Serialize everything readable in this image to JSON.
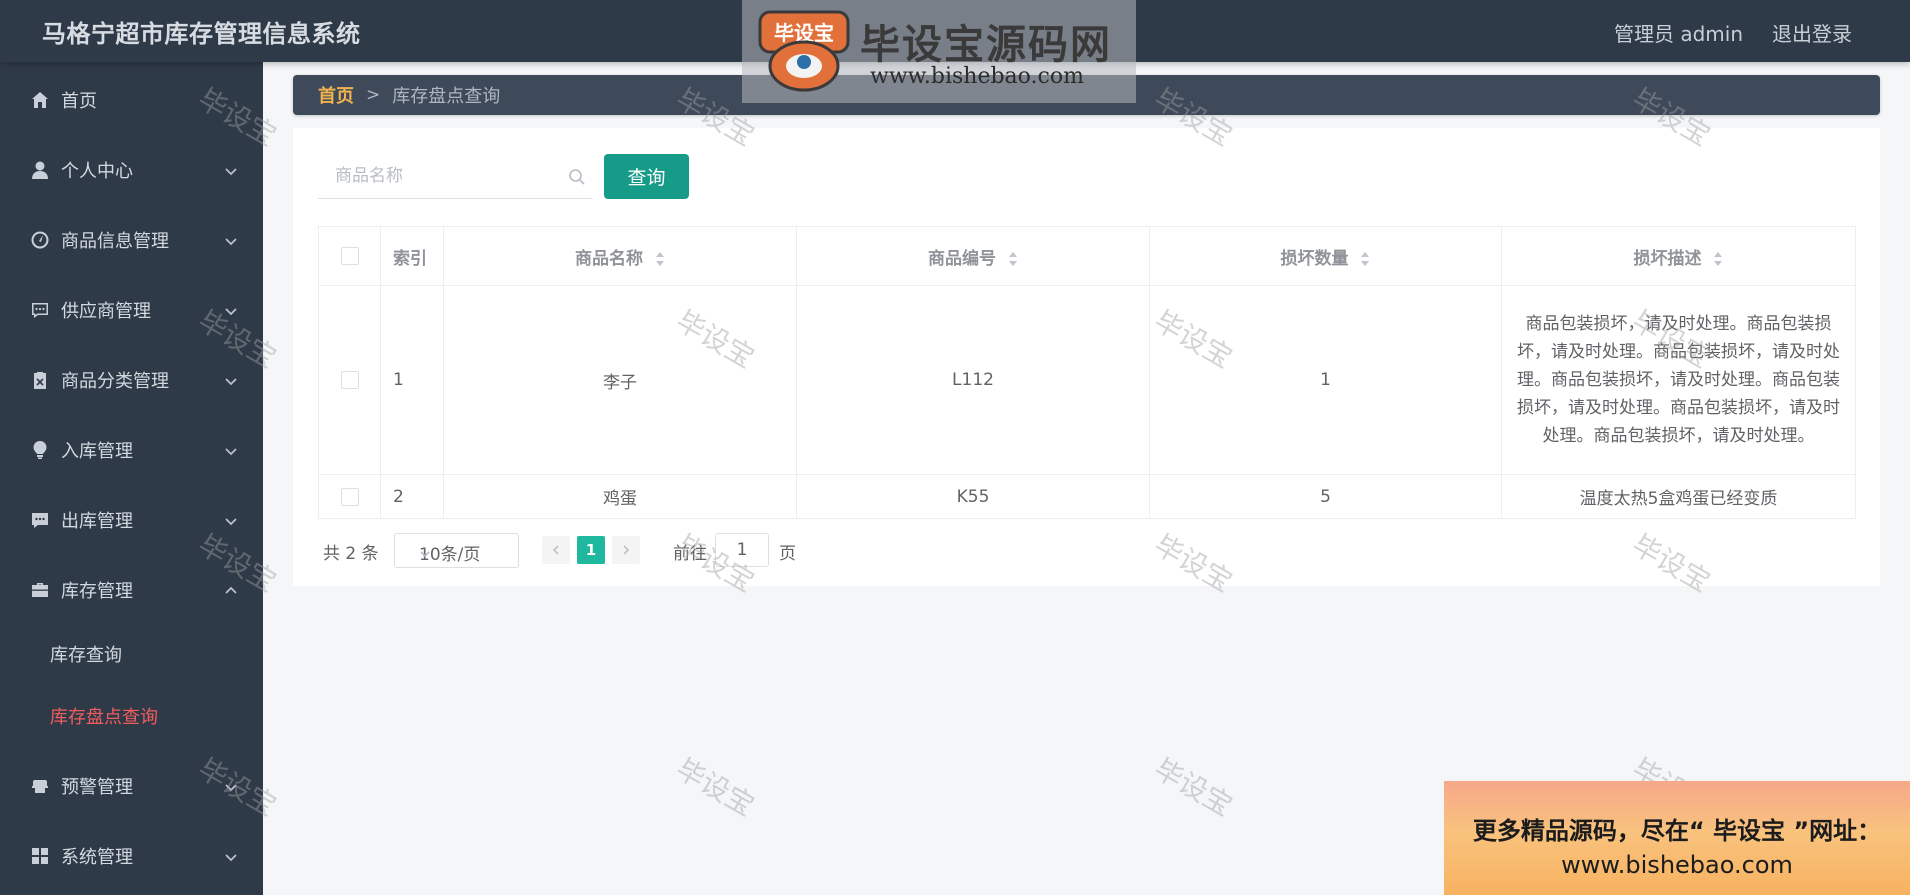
{
  "header": {
    "app_title": "马格宁超市库存管理信息系统",
    "admin_label": "管理员 admin",
    "logout_label": "退出登录"
  },
  "sidebar": {
    "items": [
      {
        "label": "首页",
        "icon": "home-icon",
        "has_arrow": false
      },
      {
        "label": "个人中心",
        "icon": "user-icon",
        "has_arrow": true
      },
      {
        "label": "商品信息管理",
        "icon": "gauge-icon",
        "has_arrow": true
      },
      {
        "label": "供应商管理",
        "icon": "chat-icon",
        "has_arrow": true
      },
      {
        "label": "商品分类管理",
        "icon": "clipboard-icon",
        "has_arrow": true
      },
      {
        "label": "入库管理",
        "icon": "bulb-icon",
        "has_arrow": true
      },
      {
        "label": "出库管理",
        "icon": "message-icon",
        "has_arrow": true
      },
      {
        "label": "库存管理",
        "icon": "briefcase-icon",
        "has_arrow": true,
        "expanded": true
      },
      {
        "label": "预警管理",
        "icon": "printer-icon",
        "has_arrow": true
      },
      {
        "label": "系统管理",
        "icon": "grid-icon",
        "has_arrow": true
      }
    ],
    "submenu": [
      {
        "label": "库存查询",
        "active": false
      },
      {
        "label": "库存盘点查询",
        "active": true
      }
    ]
  },
  "breadcrumb": {
    "home": "首页",
    "separator": ">",
    "current": "库存盘点查询"
  },
  "search": {
    "placeholder": "商品名称",
    "value": "",
    "button_label": "查询"
  },
  "table": {
    "headers": [
      "索引",
      "商品名称",
      "商品编号",
      "损坏数量",
      "损坏描述"
    ],
    "rows": [
      {
        "index": "1",
        "name": "李子",
        "code": "L112",
        "damage_qty": "1",
        "desc": "商品包装损坏，请及时处理。商品包装损坏，请及时处理。商品包装损坏，请及时处理。商品包装损坏，请及时处理。商品包装损坏，请及时处理。商品包装损坏，请及时处理。商品包装损坏，请及时处理。"
      },
      {
        "index": "2",
        "name": "鸡蛋",
        "code": "K55",
        "damage_qty": "5",
        "desc": "温度太热5盒鸡蛋已经变质"
      }
    ]
  },
  "pagination": {
    "total": "共 2 条",
    "page_size": "10条/页",
    "current_page": "1",
    "goto_label": "前往",
    "goto_value": "1",
    "page_unit": "页"
  },
  "watermark": {
    "text": "毕设宝"
  },
  "logo": {
    "badge_text": "毕设宝",
    "title": "毕设宝源码网",
    "url": "www.bishebao.com"
  },
  "promo": {
    "line1": "更多精品源码，尽在“ 毕设宝 ”网址：",
    "line2": "www.bishebao.com"
  },
  "colors": {
    "header_bg": "#2f3a48",
    "accent": "#169b88",
    "active_menu": "#f25c5c",
    "breadcrumb_home": "#f2b24e"
  }
}
